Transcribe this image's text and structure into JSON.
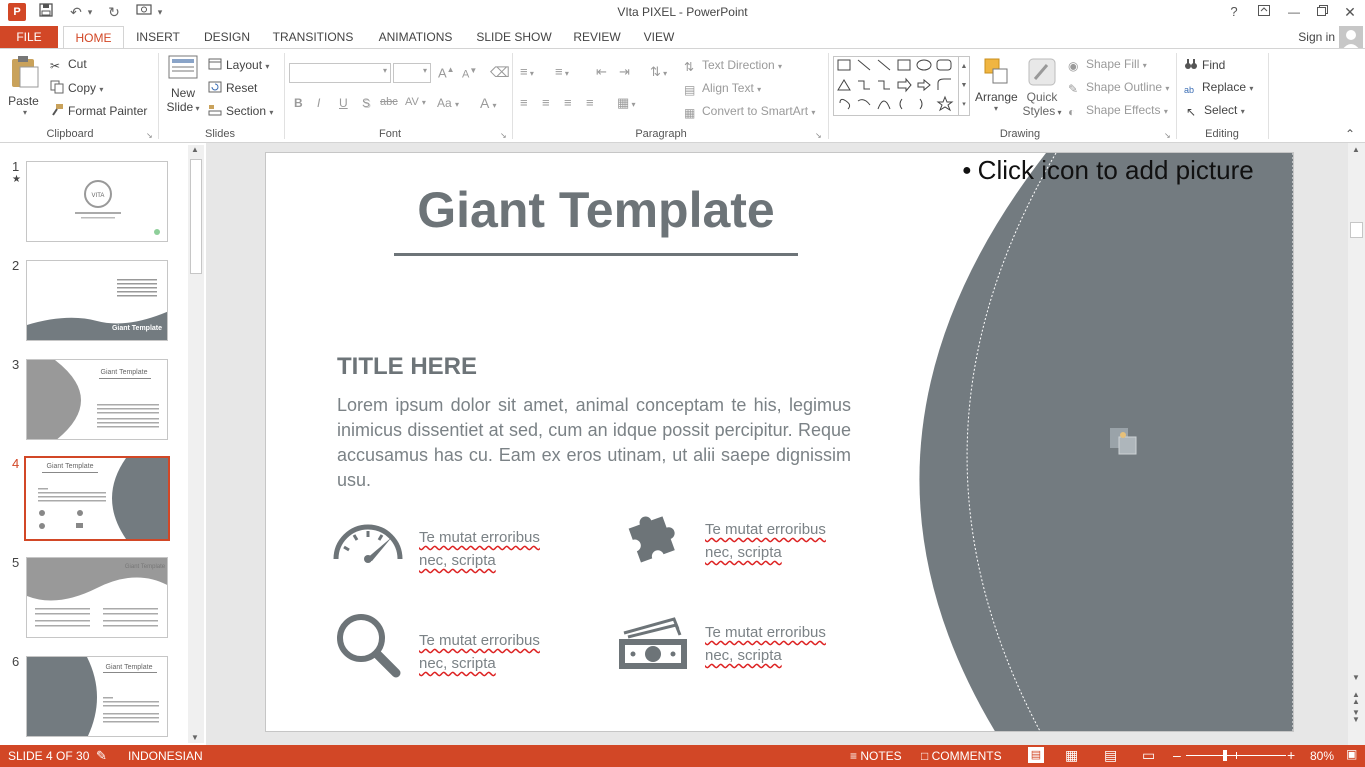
{
  "window": {
    "title": "VIta PIXEL - PowerPoint",
    "logo": "P"
  },
  "titlebar_buttons": {
    "help": "?"
  },
  "tabs": [
    "FILE",
    "HOME",
    "INSERT",
    "DESIGN",
    "TRANSITIONS",
    "ANIMATIONS",
    "SLIDE SHOW",
    "REVIEW",
    "VIEW"
  ],
  "active_tab": "HOME",
  "account": {
    "signin": "Sign in"
  },
  "ribbon": {
    "clipboard": {
      "label": "Clipboard",
      "paste": "Paste",
      "cut": "Cut",
      "copy": "Copy",
      "format_painter": "Format Painter"
    },
    "slides": {
      "label": "Slides",
      "new_slide_1": "New",
      "new_slide_2": "Slide",
      "layout": "Layout",
      "reset": "Reset",
      "section": "Section"
    },
    "font": {
      "label": "Font",
      "bold": "B",
      "italic": "I",
      "underline": "U",
      "shadow": "S",
      "strike": "abc",
      "spacing": "AV",
      "case": "Aa",
      "color": "A",
      "grow": "A",
      "shrink": "A"
    },
    "paragraph": {
      "label": "Paragraph",
      "text_direction": "Text Direction",
      "align_text": "Align Text",
      "smartart": "Convert to SmartArt"
    },
    "drawing": {
      "label": "Drawing",
      "arrange": "Arrange",
      "quick_styles_1": "Quick",
      "quick_styles_2": "Styles",
      "shape_fill": "Shape Fill",
      "shape_outline": "Shape Outline",
      "shape_effects": "Shape Effects"
    },
    "editing": {
      "label": "Editing",
      "find": "Find",
      "replace": "Replace",
      "select": "Select"
    }
  },
  "thumbnails": {
    "numbers": [
      "1",
      "2",
      "3",
      "4",
      "5",
      "6"
    ],
    "selected": "4",
    "star": "★",
    "title_text": "Giant Template"
  },
  "slide": {
    "title": "Giant Template",
    "picture_placeholder": "Click icon to add picture",
    "heading": "TITLE HERE",
    "body": "Lorem ipsum dolor sit amet, animal conceptam te his, legimus inimicus dissentiet at sed, cum an idque possit percipitur. Reque accusamus has cu. Eam ex eros utinam, ut alii saepe dignissim usu.",
    "features": [
      {
        "line1": "Te mutat erroribus",
        "line2": "nec, scripta"
      },
      {
        "line1": "Te mutat erroribus",
        "line2": "nec, scripta"
      },
      {
        "line1": "Te mutat erroribus",
        "line2": "nec, scripta"
      },
      {
        "line1": "Te mutat erroribus",
        "line2": "nec, scripta"
      }
    ]
  },
  "status": {
    "slide_info": "SLIDE 4 OF 30",
    "language": "INDONESIAN",
    "notes": "NOTES",
    "comments": "COMMENTS",
    "zoom": "80%",
    "zoom_value": 80
  },
  "colors": {
    "accent": "#d24726",
    "shape_gray": "#737b80",
    "text_gray": "#6d7478"
  }
}
